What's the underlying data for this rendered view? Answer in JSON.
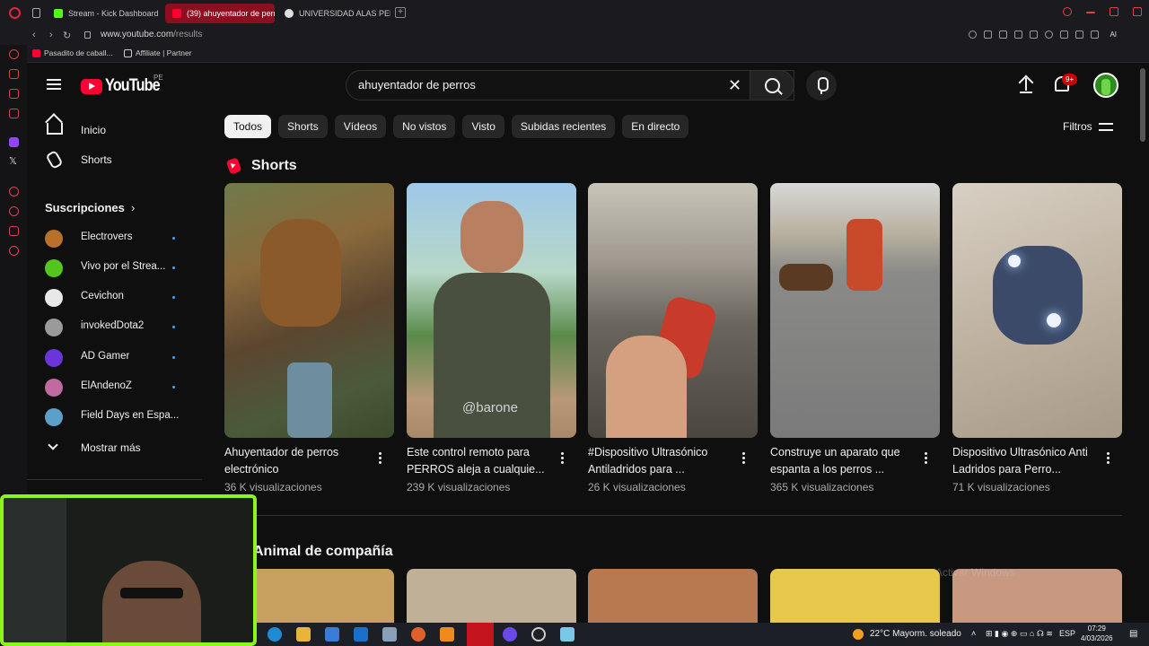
{
  "browser": {
    "tabs": [
      {
        "label": "Stream - Kick Dashboard",
        "active": false,
        "color": "#53fc18"
      },
      {
        "label": "(39) ahuyentador de perro",
        "active": true,
        "color": "#ff0033"
      },
      {
        "label": "UNIVERSIDAD ALAS PERÚ",
        "active": false,
        "color": "#e0e0e0"
      }
    ],
    "url_host": "www.youtube.com",
    "url_path": "/results",
    "ai_label": "AI",
    "bookmarks": [
      {
        "label": "Pasadito de caball...",
        "color": "#ff0033"
      },
      {
        "label": "Affiliate | Partner",
        "color": "#d0d0d0"
      }
    ]
  },
  "youtube": {
    "logo_text": "YouTube",
    "country": "PE",
    "search_value": "ahuyentador de perros",
    "notif_count": "9+",
    "sidebar": {
      "home": "Inicio",
      "shorts": "Shorts",
      "subs_title": "Suscripciones",
      "channels": [
        {
          "name": "Electrovers",
          "color": "#b8702a"
        },
        {
          "name": "Vivo por el Strea...",
          "color": "#53c51e"
        },
        {
          "name": "Cevichon",
          "color": "#e8e8e8"
        },
        {
          "name": "invokedDota2",
          "color": "#9a9a9a"
        },
        {
          "name": "AD Gamer",
          "color": "#6a35d9"
        },
        {
          "name": "ElAndenoZ",
          "color": "#c06aa0"
        },
        {
          "name": "Field Days en Espa...",
          "color": "#5aa0c8"
        }
      ],
      "show_more": "Mostrar más"
    },
    "chips": [
      "Todos",
      "Shorts",
      "Vídeos",
      "No vistos",
      "Visto",
      "Subidas recientes",
      "En directo"
    ],
    "filters": "Filtros",
    "shorts_heading": "Shorts",
    "shorts": [
      {
        "title": "Ahuyentador de perros electrónico",
        "views": "36 K visualizaciones"
      },
      {
        "title": "Este control remoto para PERROS aleja a cualquie...",
        "views": "239 K visualizaciones",
        "watermark": "@barone"
      },
      {
        "title": "#Dispositivo Ultrasónico Antiladridos para ...",
        "views": "26 K visualizaciones"
      },
      {
        "title": "Construye un aparato que espanta a los perros ...",
        "views": "365 K visualizaciones"
      },
      {
        "title": "Dispositivo Ultrasónico Anti Ladridos para Perro...",
        "views": "71 K visualizaciones"
      }
    ],
    "second_heading": "Animal de compañía",
    "activate_windows": "Activar Windows"
  },
  "taskbar": {
    "weather": "22°C  Mayorm. soleado",
    "lang": "ESP",
    "time": "07:29",
    "date": "4/03/2026"
  }
}
